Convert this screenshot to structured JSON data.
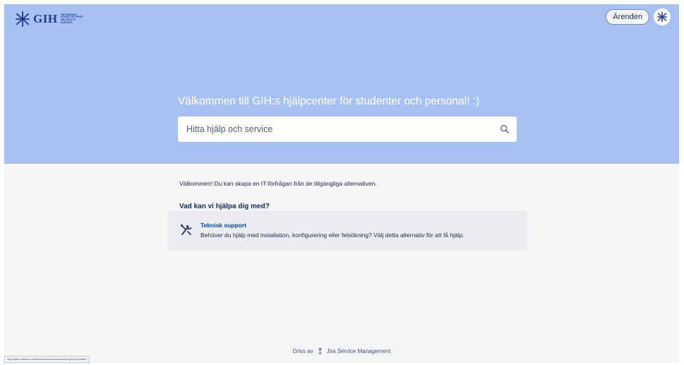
{
  "header": {
    "logo": {
      "wordmark": "GIH",
      "tagline": "THE SWEDISH SCHOOL OF SPORT AND HEALTH SCIENCES",
      "icon": "gih-emblem-icon"
    },
    "requests_label": "Ärenden",
    "avatar_icon": "gih-emblem-icon"
  },
  "hero": {
    "title": "Välkommen till GIH:s hjälpcenter för studenter och personal! :)",
    "search_placeholder": "Hitta hjälp och service",
    "search_icon": "search-icon"
  },
  "main": {
    "welcome_text": "Välkommen! Du kan skapa en IT-förfrågan från de tillgängliga alternativen.",
    "help_heading": "Vad kan vi hjälpa dig med?",
    "options": [
      {
        "title": "Teknisk support",
        "description": "Behöver du hjälp med installation, konfigurering eller felsökning? Välj detta alternativ för att få hjälp.",
        "icon": "tools-icon"
      }
    ]
  },
  "footer": {
    "powered_by": "Drivs av",
    "product": "Jira Service Management",
    "icon": "jira-icon"
  },
  "status_bar": {
    "url": "https://gihse.atlassian.net/servicedesk/customer/portal/1/group/1/create/1"
  },
  "colors": {
    "hero_bg": "#a6c1f2",
    "page_bg": "#f4f5f7",
    "card_bg": "#ebecf0",
    "link": "#0747a6",
    "text": "#172b4d"
  }
}
